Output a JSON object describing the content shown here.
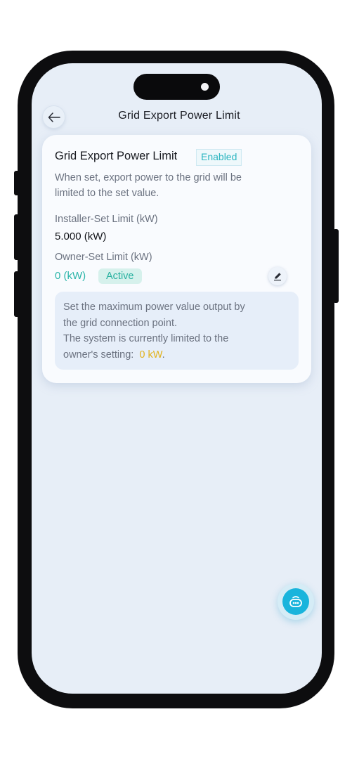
{
  "header": {
    "title": "Grid Export Power Limit",
    "back_icon": "arrow-left-icon"
  },
  "card": {
    "title": "Grid Export Power Limit",
    "status_badge": "Enabled",
    "description_line1": "When set, export power to the grid will be",
    "description_line2": "limited to the set value.",
    "installer_label": "Installer-Set Limit (kW)",
    "installer_value": "5.000 (kW)",
    "owner_label": "Owner-Set Limit (kW)",
    "owner_value": "0 (kW)",
    "owner_status": "Active",
    "edit_icon": "pencil-icon",
    "info": {
      "line1": "Set the maximum power value output by",
      "line2": "the grid connection point.",
      "line3": "The system is currently limited to the",
      "line4_prefix": "owner's setting:",
      "line4_value": "0 kW",
      "line4_suffix": "."
    }
  },
  "fab": {
    "icon": "assistant-bot-icon"
  },
  "colors": {
    "accent_teal": "#2bb5a9",
    "highlight_yellow": "#e2b21a",
    "screen_bg": "#e7eef7",
    "fab_blue": "#19b4dc"
  }
}
